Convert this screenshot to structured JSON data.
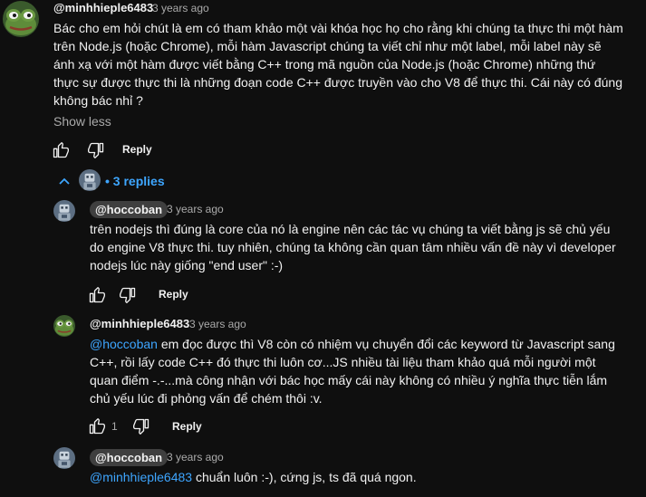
{
  "comment": {
    "author": "@minhhieple6483",
    "time": "3 years ago",
    "text": "Bác cho em hỏi chút là em có tham khảo một vài khóa học họ cho rằng khi chúng ta thực thi một hàm trên Node.js (hoặc Chrome), mỗi hàm Javascript chúng ta viết chỉ như một label, mỗi label này sẽ ánh xạ với một hàm được viết bằng C++ trong mã nguồn của Node.js (hoặc Chrome) những thứ thực sự được thực thi là những đoạn code C++ được truyền vào cho V8 để thực thi. Cái này có đúng không bác nhỉ ?",
    "show_less": "Show less",
    "reply_label": "Reply"
  },
  "replies_toggle": {
    "bullet": "•",
    "label": "3 replies"
  },
  "replies": [
    {
      "author": "@hoccoban",
      "time": "3 years ago",
      "text": "trên nodejs thì đúng là core của nó là engine nên các tác vụ chúng ta viết bằng js sẽ chủ yếu do engine V8 thực thi. tuy nhiên, chúng ta không cần quan tâm nhiều vấn đề này vì developer nodejs lúc này giống \"end user\" :-)",
      "reply_label": "Reply"
    },
    {
      "author": "@minhhieple6483",
      "time": "3 years ago",
      "mention": "@hoccoban",
      "text": " em đọc được thì V8 còn có nhiệm vụ chuyển đổi các keyword từ Javascript sang C++, rồi lấy code C++ đó thực thi luôn cơ...JS nhiều tài liệu tham khảo quá mỗi người một quan điểm -.-...mà công nhận với bác học mấy cái này không có nhiều ý nghĩa thực tiễn lắm chủ yếu lúc đi phỏng vấn để chém thôi :v.",
      "likes": "1",
      "reply_label": "Reply"
    },
    {
      "author": "@hoccoban",
      "time": "3 years ago",
      "mention": "@minhhieple6483",
      "text": " chuẩn luôn :-), cứng js, ts đã quá ngon."
    }
  ],
  "icons": {
    "like": "thumb-up-icon",
    "dislike": "thumb-down-icon",
    "collapse": "chevron-up-icon"
  },
  "colors": {
    "background": "#0f0f0f",
    "text": "#f1f1f1",
    "secondary": "#aaaaaa",
    "link": "#3ea6ff",
    "chip": "#3f3f3f"
  }
}
